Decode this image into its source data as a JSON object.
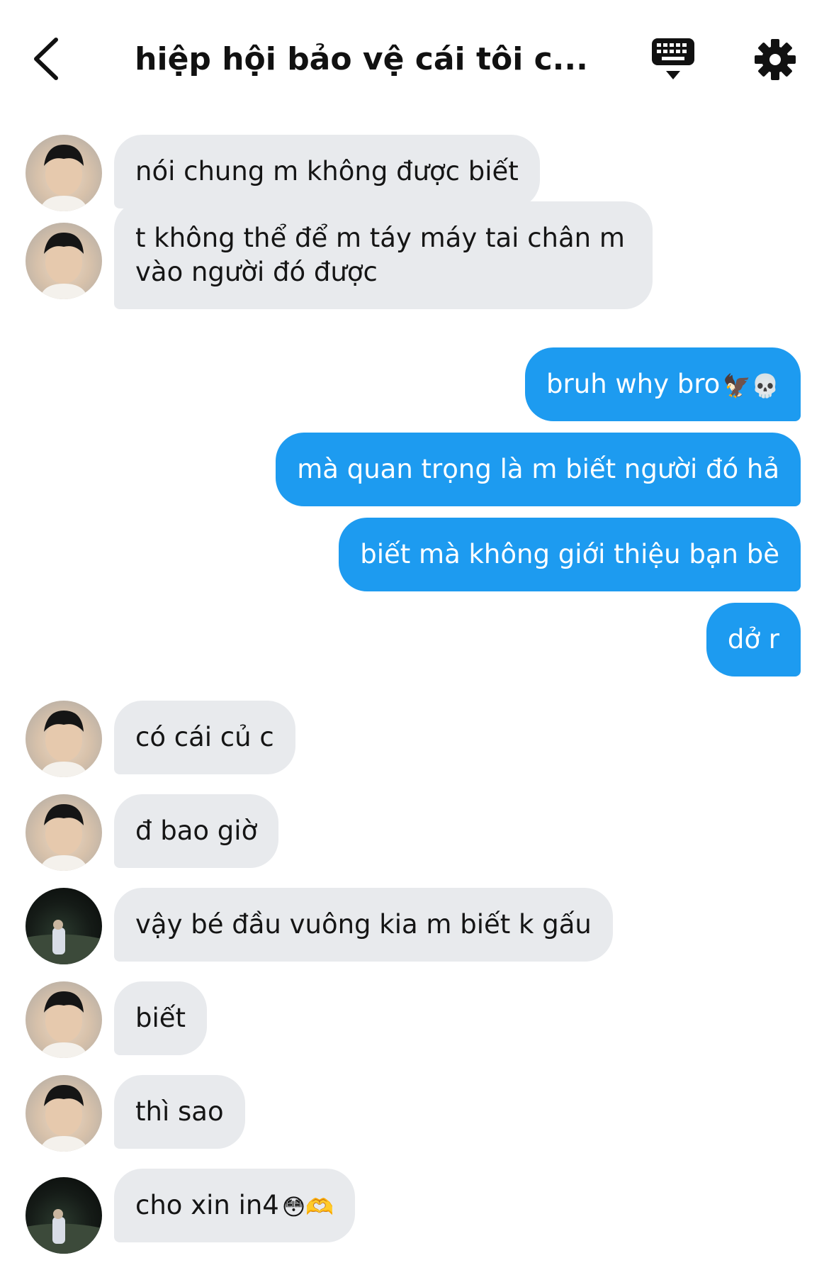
{
  "header": {
    "title": "hiệp hội bảo vệ cái tôi c...",
    "back_icon": "chevron-left-icon",
    "keyboard_icon": "keyboard-icon",
    "settings_icon": "gear-icon"
  },
  "colors": {
    "outgoing_bubble": "#1d9bf0",
    "incoming_bubble": "#e8eaed",
    "background": "#ffffff"
  },
  "messages": [
    {
      "side": "in",
      "avatar": "avatar-light",
      "text": "nói chung m không được biết"
    },
    {
      "side": "in",
      "avatar": "avatar-light",
      "text": "t không thể để m táy máy tai chân m vào người đó được"
    },
    {
      "side": "out",
      "text": "bruh why bro",
      "emoji": "🦅💀"
    },
    {
      "side": "out",
      "text": "mà quan trọng là m biết người đó hả"
    },
    {
      "side": "out",
      "text": "biết mà không giới thiệu bạn bè"
    },
    {
      "side": "out",
      "text": "dở r"
    },
    {
      "side": "in",
      "avatar": "avatar-light",
      "text": "có cái củ c"
    },
    {
      "side": "in",
      "avatar": "avatar-light",
      "text": "đ bao giờ"
    },
    {
      "side": "in",
      "avatar": "avatar-dark",
      "text": "vậy bé đầu vuông kia m biết k gấu"
    },
    {
      "side": "in",
      "avatar": "avatar-light",
      "text": "biết"
    },
    {
      "side": "in",
      "avatar": "avatar-light",
      "text": "thì sao"
    },
    {
      "side": "in",
      "avatar": "avatar-dark",
      "text": "cho xin in4",
      "emoji": "😳🫶"
    }
  ]
}
